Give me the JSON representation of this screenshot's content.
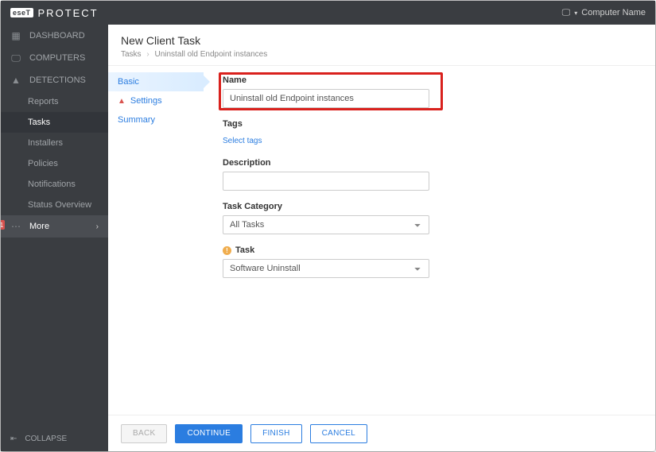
{
  "brand": {
    "logo": "eseT",
    "name": "PROTECT"
  },
  "topbar": {
    "computer_label": "Computer Name"
  },
  "sidebar": {
    "items": [
      {
        "label": "DASHBOARD"
      },
      {
        "label": "COMPUTERS"
      },
      {
        "label": "DETECTIONS"
      },
      {
        "label": "Reports"
      },
      {
        "label": "Tasks"
      },
      {
        "label": "Installers"
      },
      {
        "label": "Policies"
      },
      {
        "label": "Notifications"
      },
      {
        "label": "Status Overview"
      },
      {
        "label": "More",
        "badge": "1"
      }
    ],
    "collapse": "COLLAPSE"
  },
  "page": {
    "title": "New Client Task",
    "breadcrumb": {
      "root": "Tasks",
      "current": "Uninstall old Endpoint instances"
    }
  },
  "steps": {
    "basic": "Basic",
    "settings": "Settings",
    "summary": "Summary"
  },
  "form": {
    "name_label": "Name",
    "name_value": "Uninstall old Endpoint instances",
    "tags_label": "Tags",
    "tags_link": "Select tags",
    "desc_label": "Description",
    "desc_value": "",
    "cat_label": "Task Category",
    "cat_value": "All Tasks",
    "task_label": "Task",
    "task_value": "Software Uninstall"
  },
  "footer": {
    "back": "BACK",
    "continue": "CONTINUE",
    "finish": "FINISH",
    "cancel": "CANCEL"
  }
}
